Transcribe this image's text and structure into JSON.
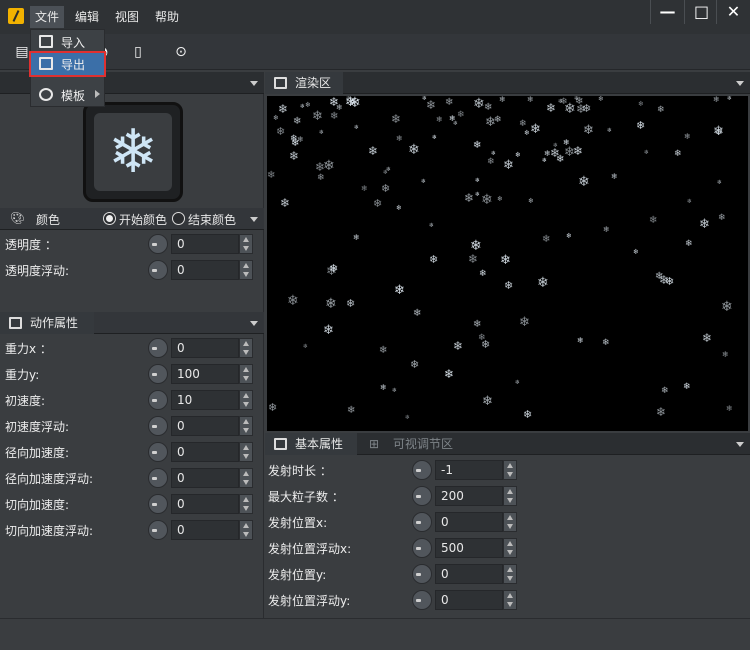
{
  "menu": {
    "file": "文件",
    "edit": "编辑",
    "view": "视图",
    "help": "帮助"
  },
  "window_controls": {
    "minimize": "—",
    "maximize": "□",
    "close": "✕"
  },
  "file_menu": {
    "import": "导入",
    "export": "导出",
    "template": "模板"
  },
  "color_section": {
    "title": "颜色",
    "start_color": "开始颜色",
    "end_color": "结束颜色",
    "selected": "start_color"
  },
  "color_props": [
    {
      "label": "透明度 ：",
      "value": "0"
    },
    {
      "label": "透明度浮动:",
      "value": "0"
    }
  ],
  "motion_section": {
    "title": "动作属性"
  },
  "motion_props": [
    {
      "label": "重力x ：",
      "value": "0"
    },
    {
      "label": "重力y:",
      "value": "100"
    },
    {
      "label": "初速度:",
      "value": "10"
    },
    {
      "label": "初速度浮动:",
      "value": "0"
    },
    {
      "label": "径向加速度:",
      "value": "0"
    },
    {
      "label": "径向加速度浮动:",
      "value": "0"
    },
    {
      "label": "切向加速度:",
      "value": "0"
    },
    {
      "label": "切向加速度浮动:",
      "value": "0"
    }
  ],
  "render_panel": {
    "title": "渲染区"
  },
  "bottom_tabs": {
    "basic": "基本属性",
    "visual": "可视调节区"
  },
  "basic_props": [
    {
      "label": "发射时长 ：",
      "value": "-1"
    },
    {
      "label": "最大粒子数 ：",
      "value": "200"
    },
    {
      "label": "发射位置x:",
      "value": "0"
    },
    {
      "label": "发射位置浮动x:",
      "value": "500"
    },
    {
      "label": "发射位置y:",
      "value": "0"
    },
    {
      "label": "发射位置浮动y:",
      "value": "0"
    }
  ],
  "icons": {
    "particle_preview": "snowflake-icon",
    "render": "render-window-icon",
    "settings": "grid-icon"
  },
  "colors": {
    "accent_highlight": "#3b6fa8",
    "highlight_border": "#e03030",
    "background": "#3a3d40",
    "render_bg": "#000000"
  }
}
